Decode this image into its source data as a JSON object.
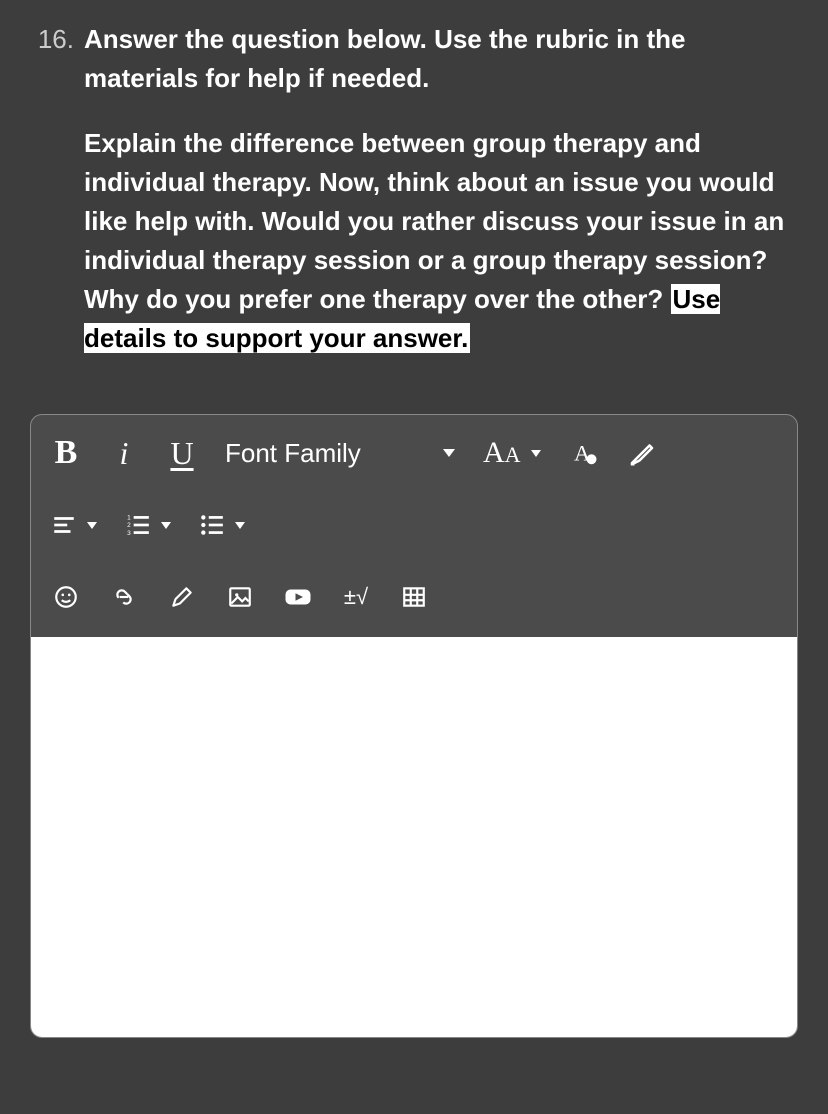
{
  "question": {
    "number": "16.",
    "instruction": "Answer the question below. Use the rubric in the materials for help if needed.",
    "prompt_main": "Explain the difference between group therapy and individual therapy. Now, think about an issue you would like help with. Would you rather discuss your issue in an individual therapy session or a group therapy session? Why do you prefer one therapy over the other? ",
    "prompt_highlight": "Use details to support your answer."
  },
  "toolbar": {
    "bold": "B",
    "italic": "i",
    "underline": "U",
    "font_family_label": "Font Family",
    "font_size_big": "A",
    "font_size_small": "A",
    "math_label": "±√"
  },
  "icons": {
    "bold": "bold-icon",
    "italic": "italic-icon",
    "underline": "underline-icon",
    "font_color": "font-color-icon",
    "highlighter": "highlighter-icon",
    "align": "align-icon",
    "ordered_list": "ordered-list-icon",
    "bullet_list": "bullet-list-icon",
    "emoji": "emoji-icon",
    "link": "link-icon",
    "draw": "draw-icon",
    "image": "image-icon",
    "video": "video-icon",
    "math": "math-icon",
    "table": "table-icon"
  }
}
